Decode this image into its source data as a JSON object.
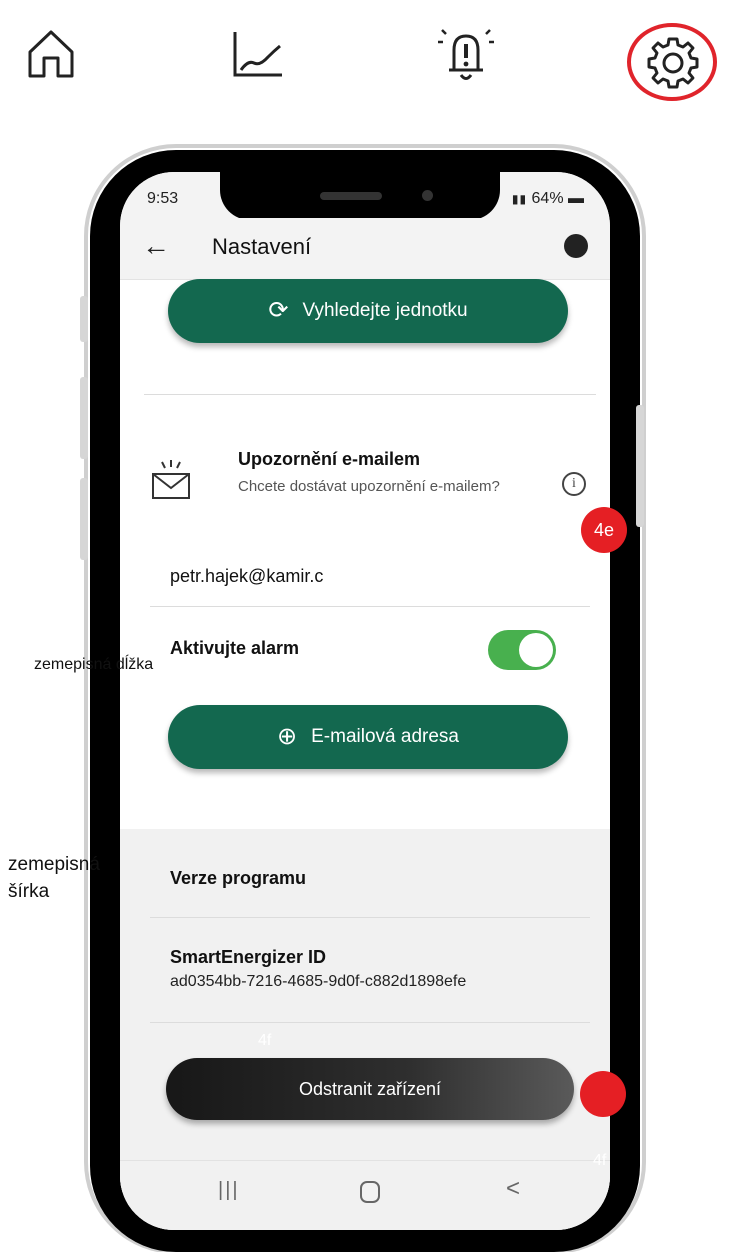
{
  "top_nav": {
    "items": [
      {
        "icon": "home-icon"
      },
      {
        "icon": "chart-icon"
      },
      {
        "icon": "alarm-bell-icon"
      },
      {
        "icon": "gear-icon",
        "selected": true
      }
    ],
    "selection_color": "#e0242b"
  },
  "status_bar": {
    "time": "9:53",
    "battery": "64%"
  },
  "app_bar": {
    "title": "Nastavení"
  },
  "search_unit_button": {
    "label": "Vyhledejte jednotku"
  },
  "email_notifications": {
    "title": "Upozornění e-mailem",
    "subtitle": "Chcete dostávat upozornění e-mailem?",
    "email": "petr.hajek@kamir.c",
    "alarm_label": "Aktivujte alarm",
    "alarm_enabled": true,
    "add_email_label": "E-mailová adresa"
  },
  "info": {
    "version_label": "Verze programu",
    "device_id_label": "SmartEnergizer ID",
    "device_id": "ad0354bb-7216-4685-9d0f-c882d1898efe"
  },
  "remove_device_button": {
    "label": "Odstranit zařízení"
  },
  "annotations": {
    "marker_4e": "4e",
    "marker_4f_top": "4f",
    "marker_4f_bottom": "4f",
    "longitude": "zemepisná dĺžka",
    "latitude_line1": "zemepisná",
    "latitude_line2": "šírka"
  },
  "colors": {
    "primary_green": "#13684f",
    "toggle_green": "#48b04e",
    "marker_red": "#e51f24"
  }
}
